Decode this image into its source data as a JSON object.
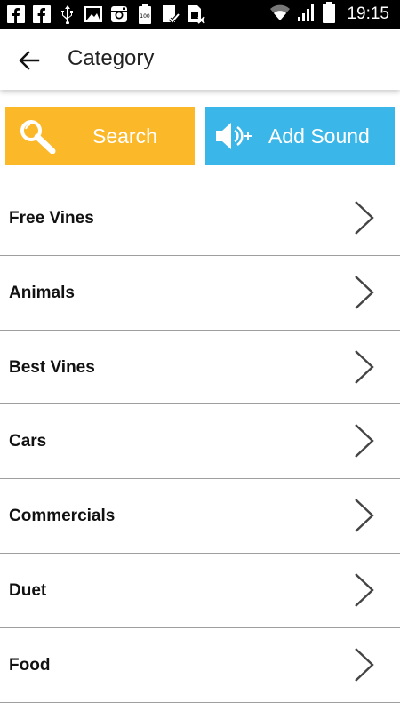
{
  "status_bar": {
    "time": "19:15",
    "left_icons": [
      "facebook-icon",
      "facebook-icon",
      "usb-icon",
      "image-icon",
      "instagram-icon",
      "battery-100-icon",
      "clipboard-check-icon",
      "sim-card-x-icon"
    ],
    "right_icons": [
      "wifi-icon",
      "cell-signal-icon",
      "battery-icon"
    ]
  },
  "app_bar": {
    "title": "Category",
    "back_icon": "arrow-left-icon"
  },
  "actions": {
    "search_label": "Search",
    "add_sound_label": "Add Sound",
    "search_color": "#fbb829",
    "add_sound_color": "#3ab7e8"
  },
  "categories": [
    {
      "label": "Free Vines"
    },
    {
      "label": "Animals"
    },
    {
      "label": "Best Vines"
    },
    {
      "label": "Cars"
    },
    {
      "label": "Commercials"
    },
    {
      "label": "Duet"
    },
    {
      "label": "Food"
    }
  ]
}
